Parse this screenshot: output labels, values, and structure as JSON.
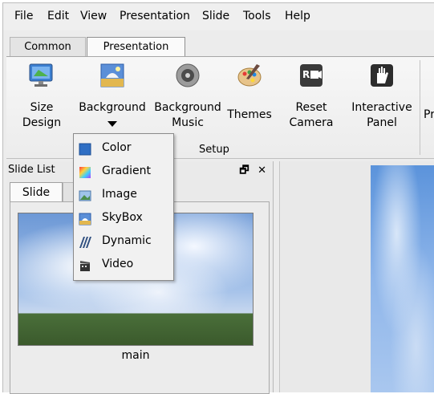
{
  "menu": [
    "File",
    "Edit",
    "View",
    "Presentation",
    "Slide",
    "Tools",
    "Help"
  ],
  "tabs": {
    "common": "Common",
    "presentation": "Presentation"
  },
  "ribbon": {
    "size_design": [
      "Size",
      "Design"
    ],
    "background": "Background",
    "background_music": [
      "Background",
      "Music"
    ],
    "themes": "Themes",
    "reset_camera": [
      "Reset",
      "Camera"
    ],
    "interactive_panel": [
      "Interactive",
      "Panel"
    ],
    "cut_label": "Pr",
    "group_label": "Setup"
  },
  "dropdown": {
    "items": [
      {
        "label": "Color",
        "icon": "color-swatch-icon"
      },
      {
        "label": "Gradient",
        "icon": "gradient-icon"
      },
      {
        "label": "Image",
        "icon": "image-icon"
      },
      {
        "label": "SkyBox",
        "icon": "skybox-icon"
      },
      {
        "label": "Dynamic",
        "icon": "dynamic-icon"
      },
      {
        "label": "Video",
        "icon": "video-icon"
      }
    ]
  },
  "slide_panel": {
    "title": "Slide List",
    "tab": "Slide",
    "float_btn": "🗗",
    "close_btn": "✕",
    "slide_name": "main"
  },
  "colors": {
    "accent": "#2f6fc4",
    "ribbon_bg": "#f2f2f2"
  }
}
